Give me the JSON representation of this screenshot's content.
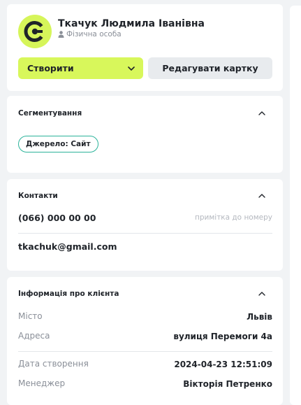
{
  "header": {
    "client_name": "Ткачук Людмила Іванівна",
    "client_type": "Фізична особа",
    "avatar_color": "#d6f55a",
    "create_label": "Створити",
    "edit_label": "Редагувати картку"
  },
  "segmentation": {
    "title": "Сегментування",
    "tags": [
      "Джерело: Сайт"
    ]
  },
  "contacts": {
    "title": "Контакти",
    "phone": "(066) 000 00 00",
    "phone_note_placeholder": "примітка до номеру",
    "email": "tkachuk@gmail.com"
  },
  "client_info": {
    "title": "Інформація про клієнта",
    "rows": [
      {
        "label": "Місто",
        "value": "Львів"
      },
      {
        "label": "Адреса",
        "value": "вулиця Перемоги 4а"
      },
      {
        "label": "Дата створення",
        "value": "2024-04-23 12:51:09"
      },
      {
        "label": "Менеджер",
        "value": "Вікторія Петренко"
      }
    ]
  },
  "colors": {
    "accent": "#d8f75b",
    "tag_border": "#2bb39a",
    "secondary_button": "#e8ebee"
  },
  "icons": [
    "brand-logo-icon",
    "person-icon",
    "chevron-down-icon",
    "chevron-up-icon"
  ]
}
